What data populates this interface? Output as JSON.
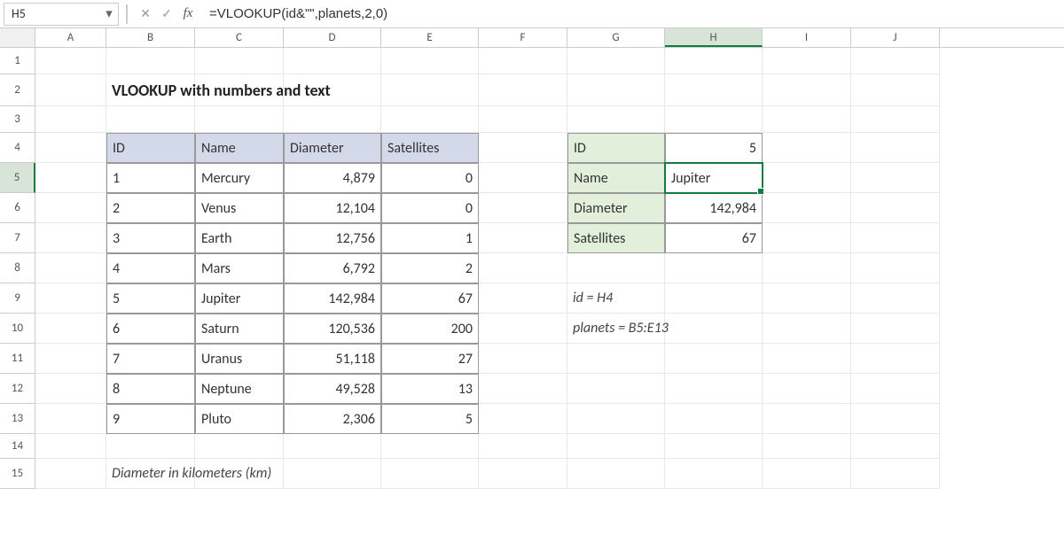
{
  "nameBox": "H5",
  "formula": "=VLOOKUP(id&\"\",planets,2,0)",
  "columns": [
    "A",
    "B",
    "C",
    "D",
    "E",
    "F",
    "G",
    "H",
    "I",
    "J"
  ],
  "activeCol": "H",
  "rows": [
    1,
    2,
    3,
    4,
    5,
    6,
    7,
    8,
    9,
    10,
    11,
    12,
    13,
    14,
    15
  ],
  "activeRow": 5,
  "rowHeights": {
    "default": 28,
    "1": 30,
    "2": 36,
    "3": 30,
    "4": 34,
    "5": 34,
    "6": 34,
    "7": 34,
    "8": 34,
    "9": 34,
    "10": 34,
    "11": 34,
    "12": 34,
    "13": 34,
    "14": 28,
    "15": 34
  },
  "title": "VLOOKUP with numbers and text",
  "table": {
    "headers": [
      "ID",
      "Name",
      "Diameter",
      "Satellites"
    ],
    "rows": [
      {
        "id": "1",
        "name": "Mercury",
        "diameter": "4,879",
        "sat": "0"
      },
      {
        "id": "2",
        "name": "Venus",
        "diameter": "12,104",
        "sat": "0"
      },
      {
        "id": "3",
        "name": "Earth",
        "diameter": "12,756",
        "sat": "1"
      },
      {
        "id": "4",
        "name": "Mars",
        "diameter": "6,792",
        "sat": "2"
      },
      {
        "id": "5",
        "name": "Jupiter",
        "diameter": "142,984",
        "sat": "67"
      },
      {
        "id": "6",
        "name": "Saturn",
        "diameter": "120,536",
        "sat": "200"
      },
      {
        "id": "7",
        "name": "Uranus",
        "diameter": "51,118",
        "sat": "27"
      },
      {
        "id": "8",
        "name": "Neptune",
        "diameter": "49,528",
        "sat": "13"
      },
      {
        "id": "9",
        "name": "Pluto",
        "diameter": "2,306",
        "sat": "5"
      }
    ]
  },
  "lookup": {
    "labels": {
      "id": "ID",
      "name": "Name",
      "diameter": "Diameter",
      "sat": "Satellites"
    },
    "values": {
      "id": "5",
      "name": "Jupiter",
      "diameter": "142,984",
      "sat": "67"
    }
  },
  "notes": {
    "line1": "id = H4",
    "line2": "planets = B5:E13"
  },
  "footnote": "Diameter in kilometers (km)"
}
